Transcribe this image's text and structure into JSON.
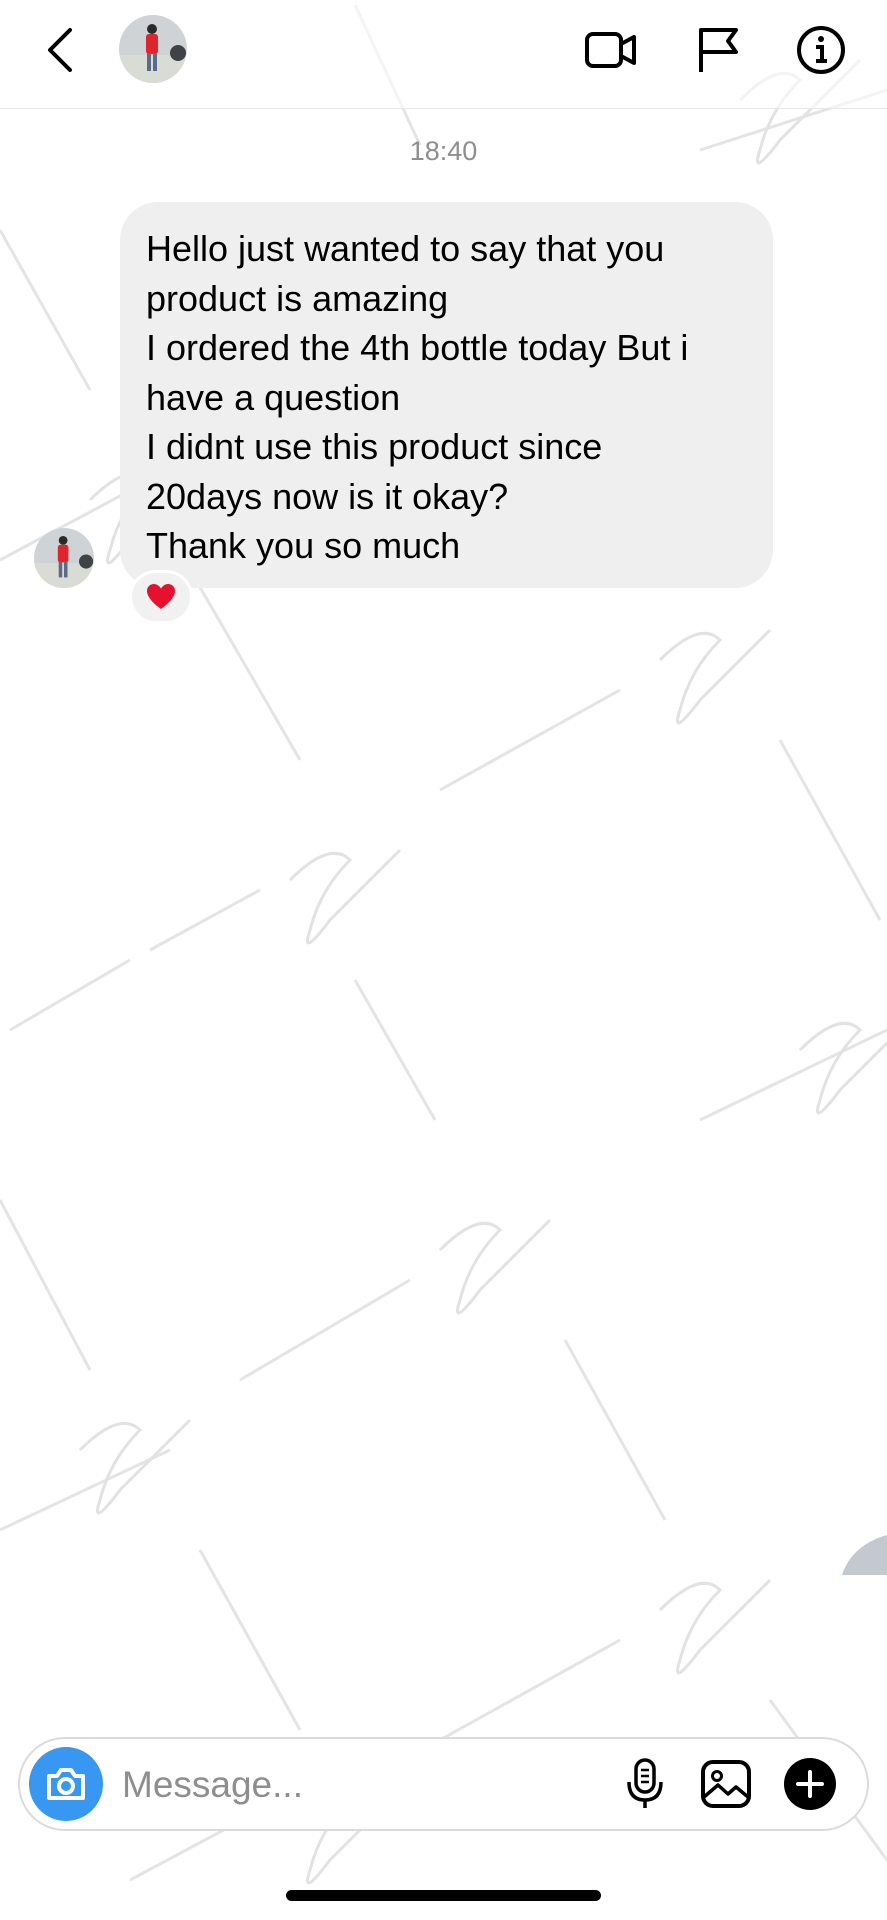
{
  "header": {
    "back_icon": "chevron-left-icon",
    "icons": [
      "video-camera-icon",
      "flag-icon",
      "info-icon"
    ]
  },
  "chat": {
    "timestamp": "18:40",
    "message_lines": [
      "Hello just wanted to say that you",
      "product is amazing",
      "I ordered the 4th bottle today But i",
      "have a question",
      "I didnt use this product since",
      "20days now is it okay?",
      "Thank you so much"
    ],
    "reaction": "❤️"
  },
  "composer": {
    "placeholder": "Message...",
    "icons": [
      "camera-icon",
      "microphone-icon",
      "gallery-icon",
      "plus-icon"
    ]
  },
  "colors": {
    "accent": "#3897f0",
    "bubble": "#efefef",
    "muted_text": "#8e8e8e"
  }
}
